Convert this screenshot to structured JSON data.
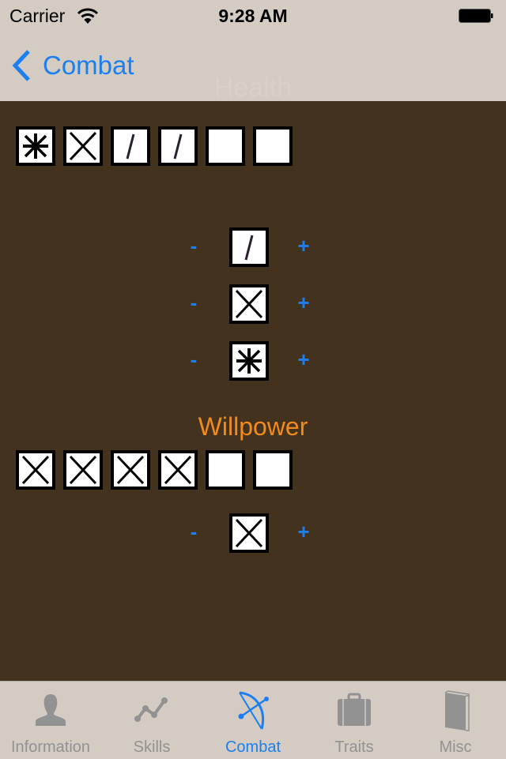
{
  "status_bar": {
    "carrier": "Carrier",
    "time": "9:28 AM",
    "battery_level": 1.0
  },
  "nav": {
    "back_label": "Combat",
    "title": "Health"
  },
  "health": {
    "track": [
      "asterisk",
      "x",
      "slash",
      "slash",
      "empty",
      "empty"
    ],
    "steppers": [
      {
        "mark": "slash",
        "minus": "-",
        "plus": "+"
      },
      {
        "mark": "x",
        "minus": "-",
        "plus": "+"
      },
      {
        "mark": "asterisk",
        "minus": "-",
        "plus": "+"
      }
    ]
  },
  "willpower": {
    "title": "Willpower",
    "track": [
      "x",
      "x",
      "x",
      "x",
      "empty",
      "empty"
    ],
    "stepper": {
      "mark": "x",
      "minus": "-",
      "plus": "+"
    }
  },
  "tabs": [
    {
      "label": "Information",
      "icon": "person-icon",
      "active": false
    },
    {
      "label": "Skills",
      "icon": "graph-icon",
      "active": false
    },
    {
      "label": "Combat",
      "icon": "bow-arrow-icon",
      "active": true
    },
    {
      "label": "Traits",
      "icon": "briefcase-icon",
      "active": false
    },
    {
      "label": "Misc",
      "icon": "book-icon",
      "active": false
    }
  ],
  "colors": {
    "accent": "#1b7ff0",
    "section_title": "#f28a1e",
    "background": "#43321e",
    "bars": "#d4cbc2"
  }
}
